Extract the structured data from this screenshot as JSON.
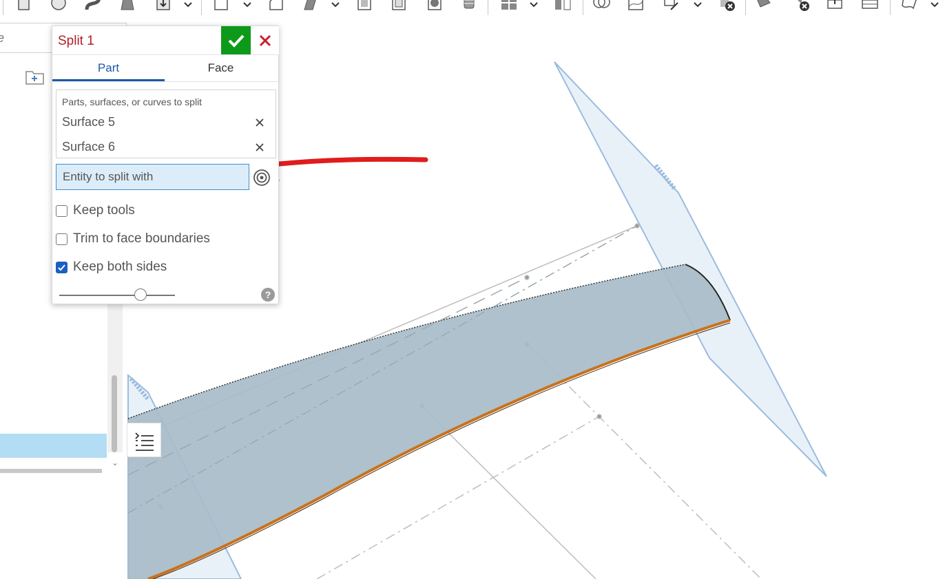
{
  "search": {
    "placeholder": "pe"
  },
  "dialog": {
    "title": "Split 1",
    "tabs": [
      {
        "label": "Part"
      },
      {
        "label": "Face"
      }
    ],
    "active_tab": "Part",
    "selection": {
      "label": "Parts, surfaces, or curves to split",
      "items": [
        "Surface 5",
        "Surface 6"
      ]
    },
    "entity_field": "Entity to split with",
    "options": [
      {
        "label": "Keep tools",
        "checked": false
      },
      {
        "label": "Trim to face boundaries",
        "checked": false
      },
      {
        "label": "Keep both sides",
        "checked": true
      }
    ],
    "slider_value": 0.7,
    "help_glyph": "?"
  },
  "colors": {
    "title": "#b01e2a",
    "accept": "#0d9a1a",
    "cancel": "#c8202b",
    "active_tab": "#1a5aa8",
    "surface": "#a7bcc8",
    "edge": "#c8721c",
    "plane": "#dbe7f4",
    "annotation_arrow": "#e01c1c"
  }
}
